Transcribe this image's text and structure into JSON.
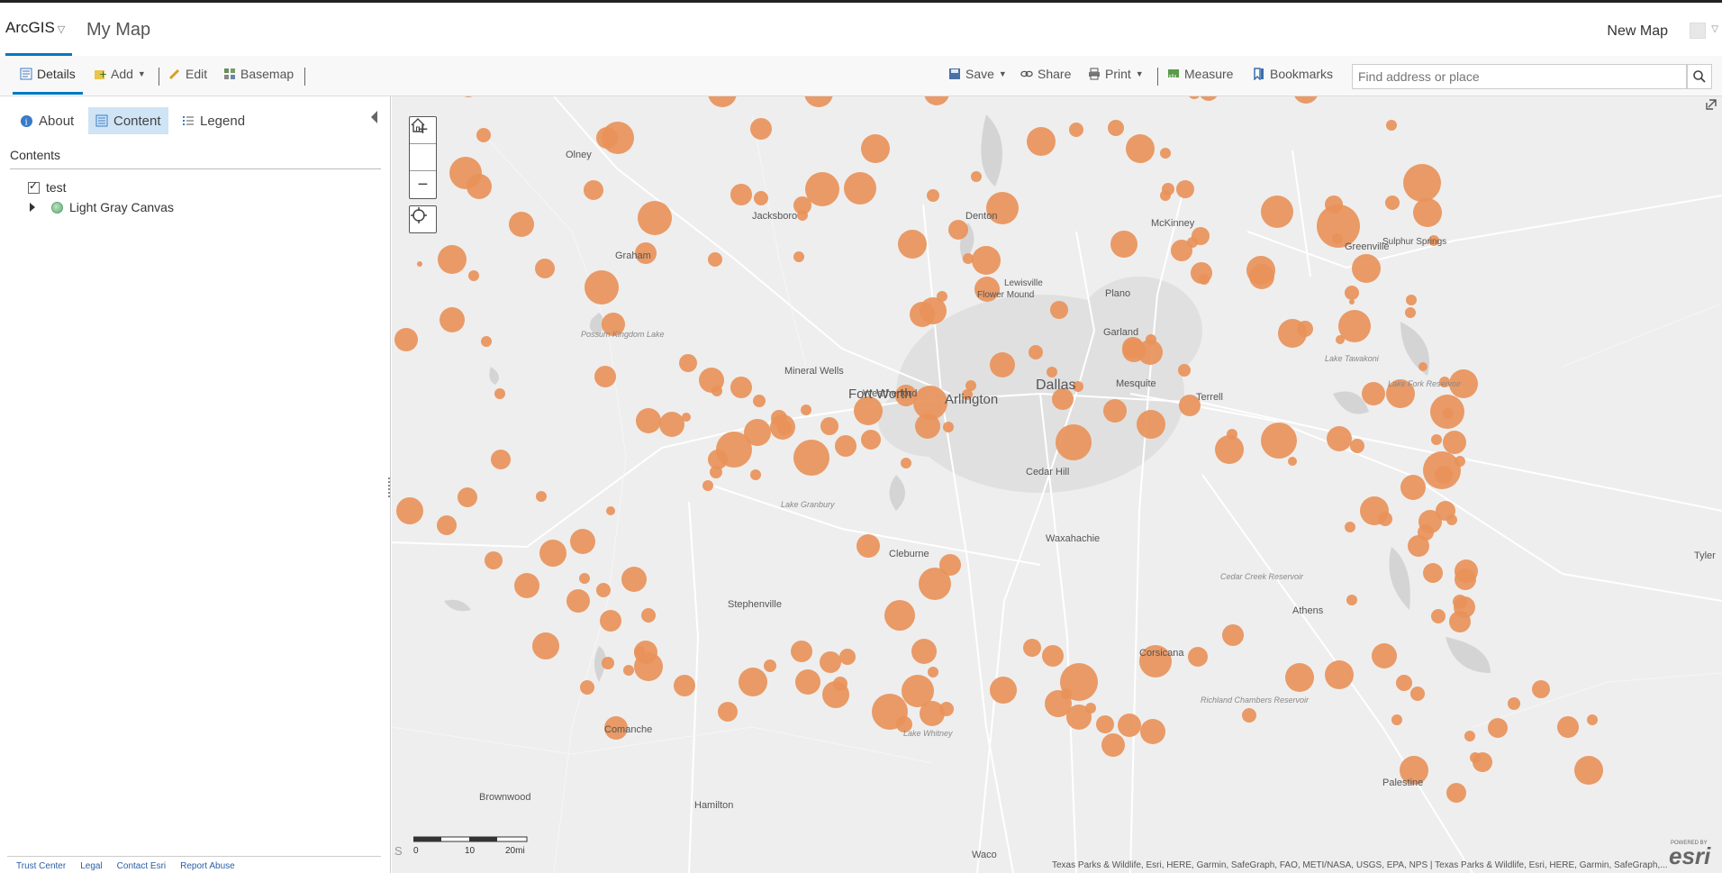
{
  "header": {
    "app_name": "ArcGIS",
    "map_title": "My Map",
    "new_map_label": "New Map"
  },
  "toolbar": {
    "details": "Details",
    "add": "Add",
    "edit": "Edit",
    "basemap": "Basemap",
    "save": "Save",
    "share": "Share",
    "print": "Print",
    "measure": "Measure",
    "bookmarks": "Bookmarks",
    "search_placeholder": "Find address or place"
  },
  "panel": {
    "tabs": {
      "about": "About",
      "content": "Content",
      "legend": "Legend"
    },
    "contents_title": "Contents",
    "layers": [
      {
        "name": "test",
        "checked": true
      },
      {
        "name": "Light Gray Canvas"
      }
    ],
    "footer_links": [
      "Trust Center",
      "Legal",
      "Contact Esri",
      "Report Abuse"
    ]
  },
  "map": {
    "attribution": "Texas Parks & Wildlife, Esri, HERE, Garmin, SafeGraph, FAO, METI/NASA, USGS, EPA, NPS | Texas Parks & Wildlife, Esri, HERE, Garmin, SafeGraph,...",
    "powered_by": "POWERED BY",
    "esri": "esri",
    "scale": {
      "labels": [
        "0",
        "10",
        "20mi"
      ]
    },
    "corner_letter": "S",
    "cities_major": [
      "Fort Worth",
      "Arlington",
      "Dallas"
    ],
    "cities": [
      "Olney",
      "Jacksboro",
      "Graham",
      "Denton",
      "McKinney",
      "Greenville",
      "Sulphur Springs",
      "Flower Mound",
      "Lewisville",
      "Plano",
      "Garland",
      "Mesquite",
      "Terrell",
      "Mineral Wells",
      "Weatherford",
      "Cedar Hill",
      "Waxahachie",
      "Cleburne",
      "Stephenville",
      "Athens",
      "Corsicana",
      "Comanche",
      "Brownwood",
      "Hamilton",
      "Palestine",
      "Waco",
      "Tyler"
    ],
    "water_labels": [
      "Possum Kingdom Lake",
      "Lake Granbury",
      "Lake Tawakoni",
      "Lake Fork Reservoir",
      "Cedar Creek Reservoir",
      "Richland Chambers Reservoir",
      "Lake Whitney"
    ],
    "symbol_color": "#e8935a",
    "background_color": "#eeeeee"
  }
}
